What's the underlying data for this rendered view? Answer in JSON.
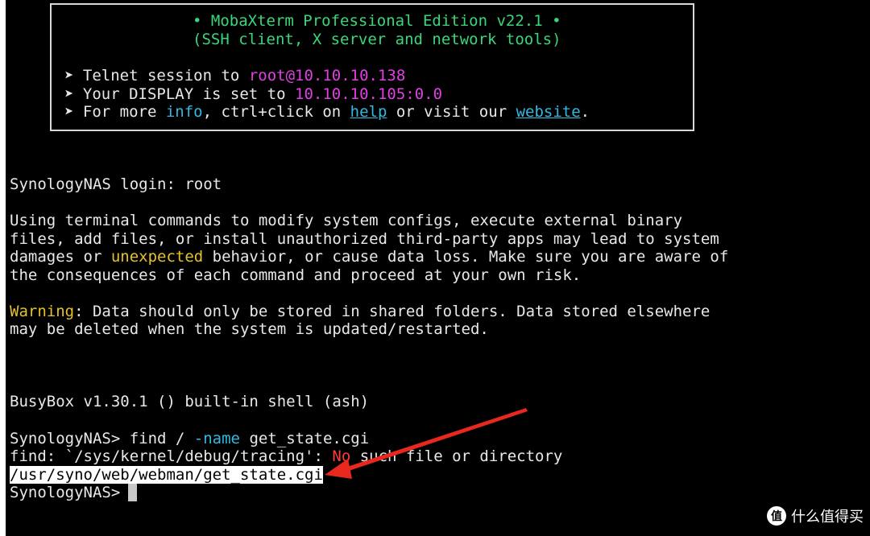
{
  "banner": {
    "title": "• MobaXterm Professional Edition v22.1 •",
    "subtitle": "(SSH client, X server and network tools)",
    "bullet": "➤",
    "telnet_prefix": "Telnet session to ",
    "telnet_target": "root@10.10.10.138",
    "display_prefix": "Your DISPLAY is set to ",
    "display_value": "10.10.10.105:0.0",
    "info_prefix": "For more ",
    "info_word": "info",
    "info_mid": ", ctrl+click on ",
    "help_link": "help",
    "info_mid2": " or visit our ",
    "website_link": "website",
    "info_end": "."
  },
  "terminal": {
    "login_line": "SynologyNAS login: root",
    "warn1": "Using terminal commands to modify system configs, execute external binary",
    "warn2": "files, add files, or install unauthorized third-party apps may lead to system",
    "warn3_a": "damages or ",
    "warn3_b": "unexpected",
    "warn3_c": " behavior, or cause data loss. Make sure you are aware of",
    "warn4": "the consequences of each command and proceed at your own risk.",
    "warning_label": "Warning",
    "warning_text1": ": Data should only be stored in shared folders. Data stored elsewhere",
    "warning_text2": "may be deleted when the system is updated/restarted.",
    "busybox": "BusyBox v1.30.1 () built-in shell (ash)",
    "prompt1": "SynologyNAS> ",
    "cmd_find": "find / ",
    "cmd_flag": "-name",
    "cmd_arg": " get_state.cgi",
    "err_a": "find: `/sys/kernel/debug/tracing': ",
    "err_no": "No",
    "err_b": " such file or directory",
    "result": "/usr/syno/web/webman/get_state.cgi",
    "prompt2": "SynologyNAS> "
  },
  "watermark": {
    "badge": "值",
    "text": "什么值得买"
  },
  "colors": {
    "background": "#000000",
    "green": "#3ad67a",
    "magenta": "#e040e0",
    "cyan": "#33b9e0",
    "yellow": "#e6c229",
    "red": "#ff3a3a",
    "arrow": "#e8281e"
  }
}
